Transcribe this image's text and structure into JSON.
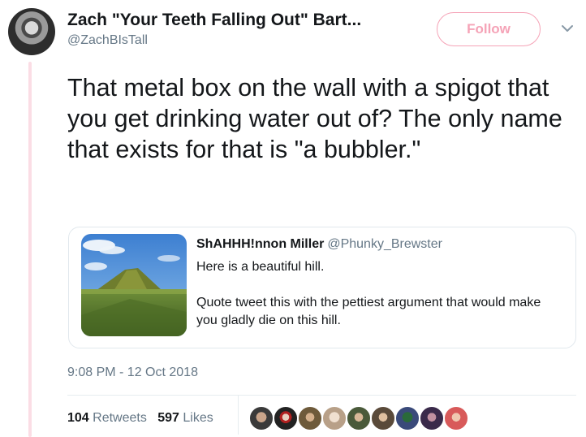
{
  "tweet": {
    "author_name": "Zach \"Your Teeth Falling Out\" Bart...",
    "author_handle": "@ZachBIsTall",
    "follow_label": "Follow",
    "text": "That metal box on the wall with a spigot that you get drinking water out of? The only name that exists for that is \"a bubbler.\"",
    "timestamp": "9:08 PM - 12 Oct 2018"
  },
  "quoted_tweet": {
    "author_name": "ShAHHH!nnon Miller",
    "author_handle": "@Phunky_Brewster",
    "line1": "Here is a beautiful hill.",
    "line2": "Quote tweet this with the pettiest argument that would make you gladly die on this hill."
  },
  "stats": {
    "retweets_count": "104",
    "retweets_label": "Retweets",
    "likes_count": "597",
    "likes_label": "Likes"
  },
  "colors": {
    "follow_accent": "#f5a3b7",
    "thread_line": "#fbdde5",
    "secondary_text": "#657786"
  },
  "icons": {
    "menu": "chevron-down-icon"
  },
  "liker_count_shown": 9
}
